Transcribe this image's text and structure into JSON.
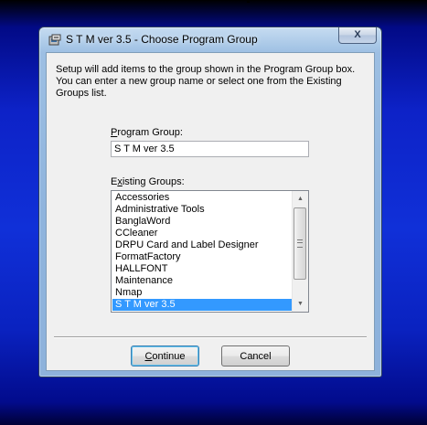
{
  "window": {
    "title": "S T M ver 3.5 - Choose Program Group",
    "close_glyph": "X"
  },
  "intro_text": "Setup will add items to the group shown in the Program Group box. You can enter a new group name or select one from the Existing Groups list.",
  "program_group": {
    "label_accel": "P",
    "label_rest": "rogram Group:",
    "value": "S T M ver 3.5"
  },
  "existing_groups": {
    "label_pre": "E",
    "label_accel": "x",
    "label_rest": "isting Groups:",
    "items": [
      "Accessories",
      "Administrative Tools",
      "BanglaWord",
      "CCleaner",
      "DRPU Card and Label Designer",
      "FormatFactory",
      "HALLFONT",
      "Maintenance",
      "Nmap",
      "S T M ver 3.5"
    ],
    "selected_index": 9
  },
  "buttons": {
    "continue_accel": "C",
    "continue_rest": "ontinue",
    "cancel_label": "Cancel"
  },
  "colors": {
    "selection": "#3399ff",
    "desktop": "#1030d8"
  }
}
